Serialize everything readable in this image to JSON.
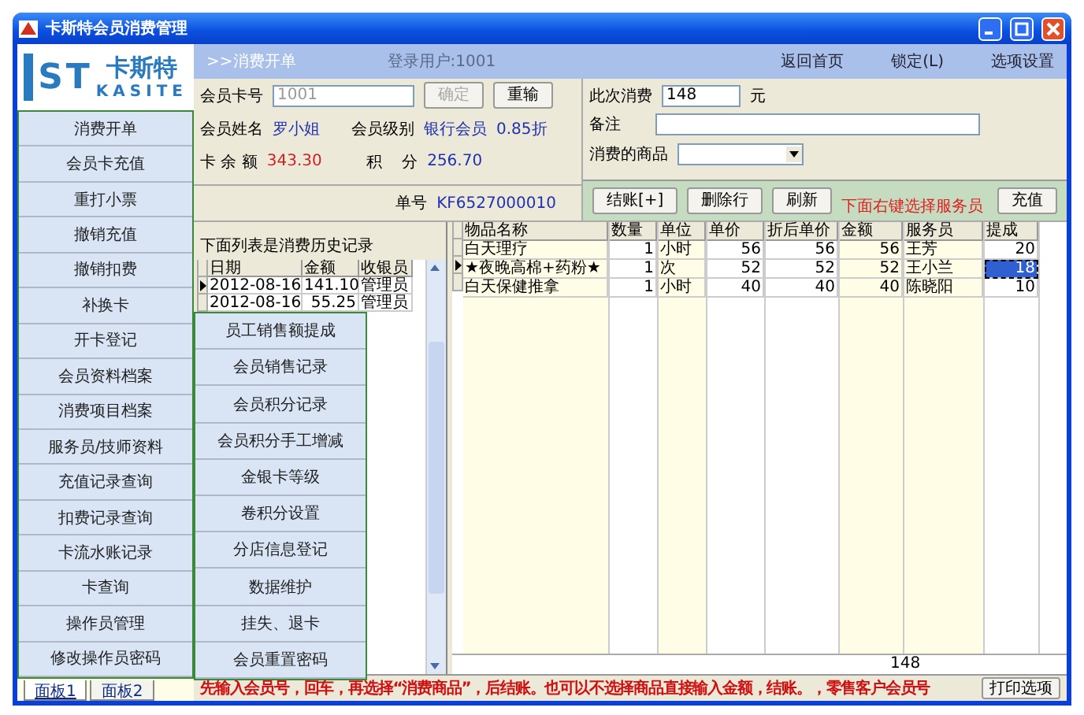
{
  "window": {
    "title": "卡斯特会员消费管理"
  },
  "logo": {
    "brand": "卡斯特",
    "letters": "ST",
    "name": "KASITE"
  },
  "sidebar": {
    "items": [
      {
        "label": "消费开单"
      },
      {
        "label": "会员卡充值"
      },
      {
        "label": "重打小票"
      },
      {
        "label": "撤销充值"
      },
      {
        "label": "撤销扣费"
      },
      {
        "label": "补换卡"
      },
      {
        "label": "开卡登记"
      },
      {
        "label": "会员资料档案"
      },
      {
        "label": "消费项目档案"
      },
      {
        "label": "服务员/技师资料"
      },
      {
        "label": "充值记录查询"
      },
      {
        "label": "扣费记录查询"
      },
      {
        "label": "卡流水账记录"
      },
      {
        "label": "卡查询"
      },
      {
        "label": "操作员管理"
      },
      {
        "label": "修改操作员密码"
      }
    ]
  },
  "panel_tabs": [
    {
      "label": "面板1",
      "selected": true
    },
    {
      "label": "面板2",
      "selected": false
    }
  ],
  "popup_menu": {
    "items": [
      "员工销售额提成",
      "会员销售记录",
      "会员积分记录",
      "会员积分手工增减",
      "金银卡等级",
      "卷积分设置",
      "分店信息登记",
      "数据维护",
      "挂失、退卡",
      "会员重置密码"
    ]
  },
  "header": {
    "breadcrumb": ">>消费开单",
    "user": "登录用户:1001",
    "links": [
      "返回首页",
      "锁定(L)",
      "选项设置"
    ]
  },
  "member": {
    "card_label": "会员卡号",
    "card_value": "1001",
    "confirm_button": {
      "label": "确定",
      "disabled": true
    },
    "reset_button": "重输",
    "name_label": "会员姓名",
    "name": "罗小姐",
    "level_label": "会员级别",
    "level": "银行会员",
    "discount": "0.85折",
    "balance_label": "卡 余 额",
    "balance": "343.30",
    "points_label": "积    分",
    "points": "256.70",
    "order_label": "单号",
    "order_no": "KF6527000010"
  },
  "consume": {
    "amount_label": "此次消费",
    "amount": "148",
    "unit": "元",
    "note_label": "备注",
    "goods_label": "消费的商品"
  },
  "actions": {
    "buttons": [
      "结账[+]",
      "删除行",
      "刷新"
    ],
    "hint": "下面右键选择服务员",
    "recharge_button": "充值"
  },
  "history": {
    "caption": "下面列表是消费历史记录",
    "columns": [
      "日期",
      "金额",
      "收银员"
    ],
    "rows": [
      {
        "cells": [
          "2012-08-16",
          "141.10",
          "管理员"
        ],
        "selected": true
      },
      {
        "cells": [
          "2012-08-16",
          "55.25",
          "管理员"
        ],
        "selected": false
      }
    ]
  },
  "goods": {
    "columns": [
      "物品名称",
      "数量",
      "单位",
      "单价",
      "折后单价",
      "金额",
      "服务员",
      "提成"
    ],
    "rows": [
      {
        "cells": [
          "白天理疗",
          "1",
          "小时",
          "56",
          "56",
          "56",
          "王芳",
          "20"
        ],
        "selected": false
      },
      {
        "cells": [
          "★夜晚高棉+药粉★",
          "1",
          "次",
          "52",
          "52",
          "52",
          "王小兰",
          "18"
        ],
        "selected": true
      },
      {
        "cells": [
          "白天保健推拿",
          "1",
          "小时",
          "40",
          "40",
          "40",
          "陈晓阳",
          "10"
        ],
        "selected": false
      }
    ],
    "total": "148"
  },
  "status_bar": {
    "message": "先输入会员号，回车，再选择“消费商品”，后结账。也可以不选择商品直接输入金额，结账。，零售客户会员号",
    "print_button": "打印选项"
  }
}
